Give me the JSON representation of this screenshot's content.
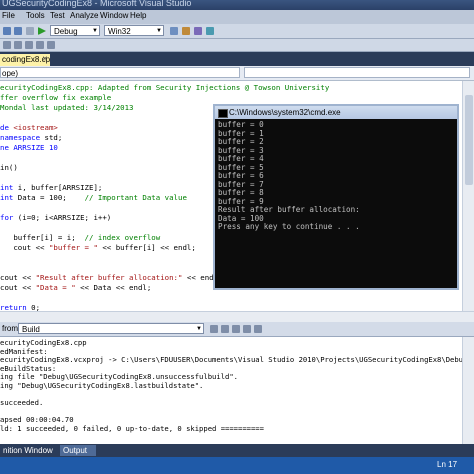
{
  "window": {
    "title": "UGSecurityCodingEx8 - Microsoft Visual Studio"
  },
  "menu": [
    "File",
    "Tools",
    "Test",
    "Analyze",
    "Window",
    "Help"
  ],
  "toolbar": {
    "config": "Debug",
    "platform": "Win32"
  },
  "doc_tab": {
    "label": "codingEx8.cpp"
  },
  "nav": {
    "scope": "ope)"
  },
  "code_lines": [
    {
      "segs": [
        [
          "cm",
          "ecurityCodingEx8.cpp: Adapted from Security Injections @ Towson University"
        ]
      ]
    },
    {
      "segs": [
        [
          "cm",
          "ffer overflow fix example"
        ]
      ]
    },
    {
      "segs": [
        [
          "cm",
          "Mondal last updated: 3/14/2013"
        ]
      ]
    },
    {
      "segs": [
        [
          "",
          ""
        ]
      ]
    },
    {
      "segs": [
        [
          "pp",
          "de "
        ],
        [
          "str",
          "<iostream>"
        ]
      ]
    },
    {
      "segs": [
        [
          "kw",
          "namespace"
        ],
        [
          "",
          " std;"
        ]
      ]
    },
    {
      "segs": [
        [
          "pp",
          "ne ARRSIZE 10"
        ]
      ]
    },
    {
      "segs": [
        [
          "",
          ""
        ]
      ]
    },
    {
      "segs": [
        [
          "",
          "in()"
        ]
      ]
    },
    {
      "segs": [
        [
          "",
          ""
        ]
      ]
    },
    {
      "segs": [
        [
          "kw",
          "int"
        ],
        [
          "",
          " i, buffer[ARRSIZE];"
        ]
      ]
    },
    {
      "segs": [
        [
          "kw",
          "int"
        ],
        [
          "",
          " Data = 100;    "
        ],
        [
          "cm",
          "// Important Data value"
        ]
      ]
    },
    {
      "segs": [
        [
          "",
          ""
        ]
      ]
    },
    {
      "segs": [
        [
          "kw",
          "for"
        ],
        [
          "",
          " (i=0; i<ARRSIZE; i++)"
        ]
      ]
    },
    {
      "segs": [
        [
          "",
          ""
        ]
      ]
    },
    {
      "segs": [
        [
          "",
          "   buffer[i] = i;  "
        ],
        [
          "cm",
          "// index overflow"
        ]
      ]
    },
    {
      "segs": [
        [
          "",
          "   cout << "
        ],
        [
          "str",
          "\"buffer = \""
        ],
        [
          "",
          " << buffer[i] << endl;"
        ]
      ]
    },
    {
      "segs": [
        [
          "",
          ""
        ]
      ]
    },
    {
      "segs": [
        [
          "",
          ""
        ]
      ]
    },
    {
      "segs": [
        [
          "",
          "cout << "
        ],
        [
          "str",
          "\"Result after buffer allocation:\""
        ],
        [
          "",
          " << endl;"
        ]
      ]
    },
    {
      "segs": [
        [
          "",
          "cout << "
        ],
        [
          "str",
          "\"Data = \""
        ],
        [
          "",
          " << Data << endl;"
        ]
      ]
    },
    {
      "segs": [
        [
          "",
          ""
        ]
      ]
    },
    {
      "segs": [
        [
          "kw",
          "return"
        ],
        [
          "",
          " 0;"
        ]
      ]
    }
  ],
  "console": {
    "title": "C:\\Windows\\system32\\cmd.exe",
    "lines": [
      "buffer = 0",
      "buffer = 1",
      "buffer = 2",
      "buffer = 3",
      "buffer = 4",
      "buffer = 5",
      "buffer = 6",
      "buffer = 7",
      "buffer = 8",
      "buffer = 9",
      "Result after buffer allocation:",
      "Data = 100",
      "Press any key to continue . . ."
    ]
  },
  "output": {
    "from_label": "from:",
    "source": "Build",
    "lines": [
      "ecurityCodingEx8.cpp",
      "edManifest:",
      "ecurityCodingEx8.vcxproj -> C:\\Users\\FDUUSER\\Documents\\Visual Studio 2010\\Projects\\UGSecurityCodingEx8\\Debug\\UGSecurityCoding",
      "eBuildStatus:",
      "ing file \"Debug\\UGSecurityCodingEx8.unsuccessfulbuild\".",
      "ing \"Debug\\UGSecurityCodingEx8.lastbuildstate\".",
      "",
      "succeeded.",
      "",
      "apsed 00:00:04.70",
      "ld: 1 succeeded, 0 failed, 0 up-to-date, 0 skipped =========="
    ]
  },
  "bottom_tabs": {
    "definition": "nition Window",
    "output": "Output"
  },
  "status": {
    "line": "Ln 17"
  }
}
